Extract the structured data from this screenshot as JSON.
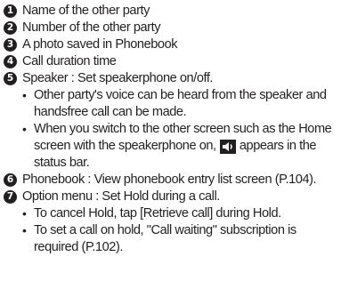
{
  "items": [
    {
      "num": "1",
      "text": "Name of the other party"
    },
    {
      "num": "2",
      "text": "Number of the other party"
    },
    {
      "num": "3",
      "text": "A photo saved in Phonebook"
    },
    {
      "num": "4",
      "text": "Call duration time"
    },
    {
      "num": "5",
      "text": "Speaker : Set speakerphone on/off."
    },
    {
      "num": "6",
      "text": "Phonebook : View phonebook entry list screen (P.104)."
    },
    {
      "num": "7",
      "text": "Option menu : Set Hold during a call."
    }
  ],
  "speaker_bullets": [
    "Other party's voice can be heard from the speaker and handsfree call can be made.",
    "When you switch to the other screen such as the Home screen with the speakerphone on,",
    "appears in the status bar."
  ],
  "option_bullets": [
    "To cancel Hold, tap [Retrieve call] during Hold.",
    "To set a call on hold, \"Call waiting\" subscription is required (P.102)."
  ],
  "bullet_char": "•",
  "icons": {
    "speaker": "speaker-icon"
  },
  "colors": {
    "text": "#231f20",
    "icon_bg": "#231f20",
    "icon_fg": "#ffffff"
  }
}
